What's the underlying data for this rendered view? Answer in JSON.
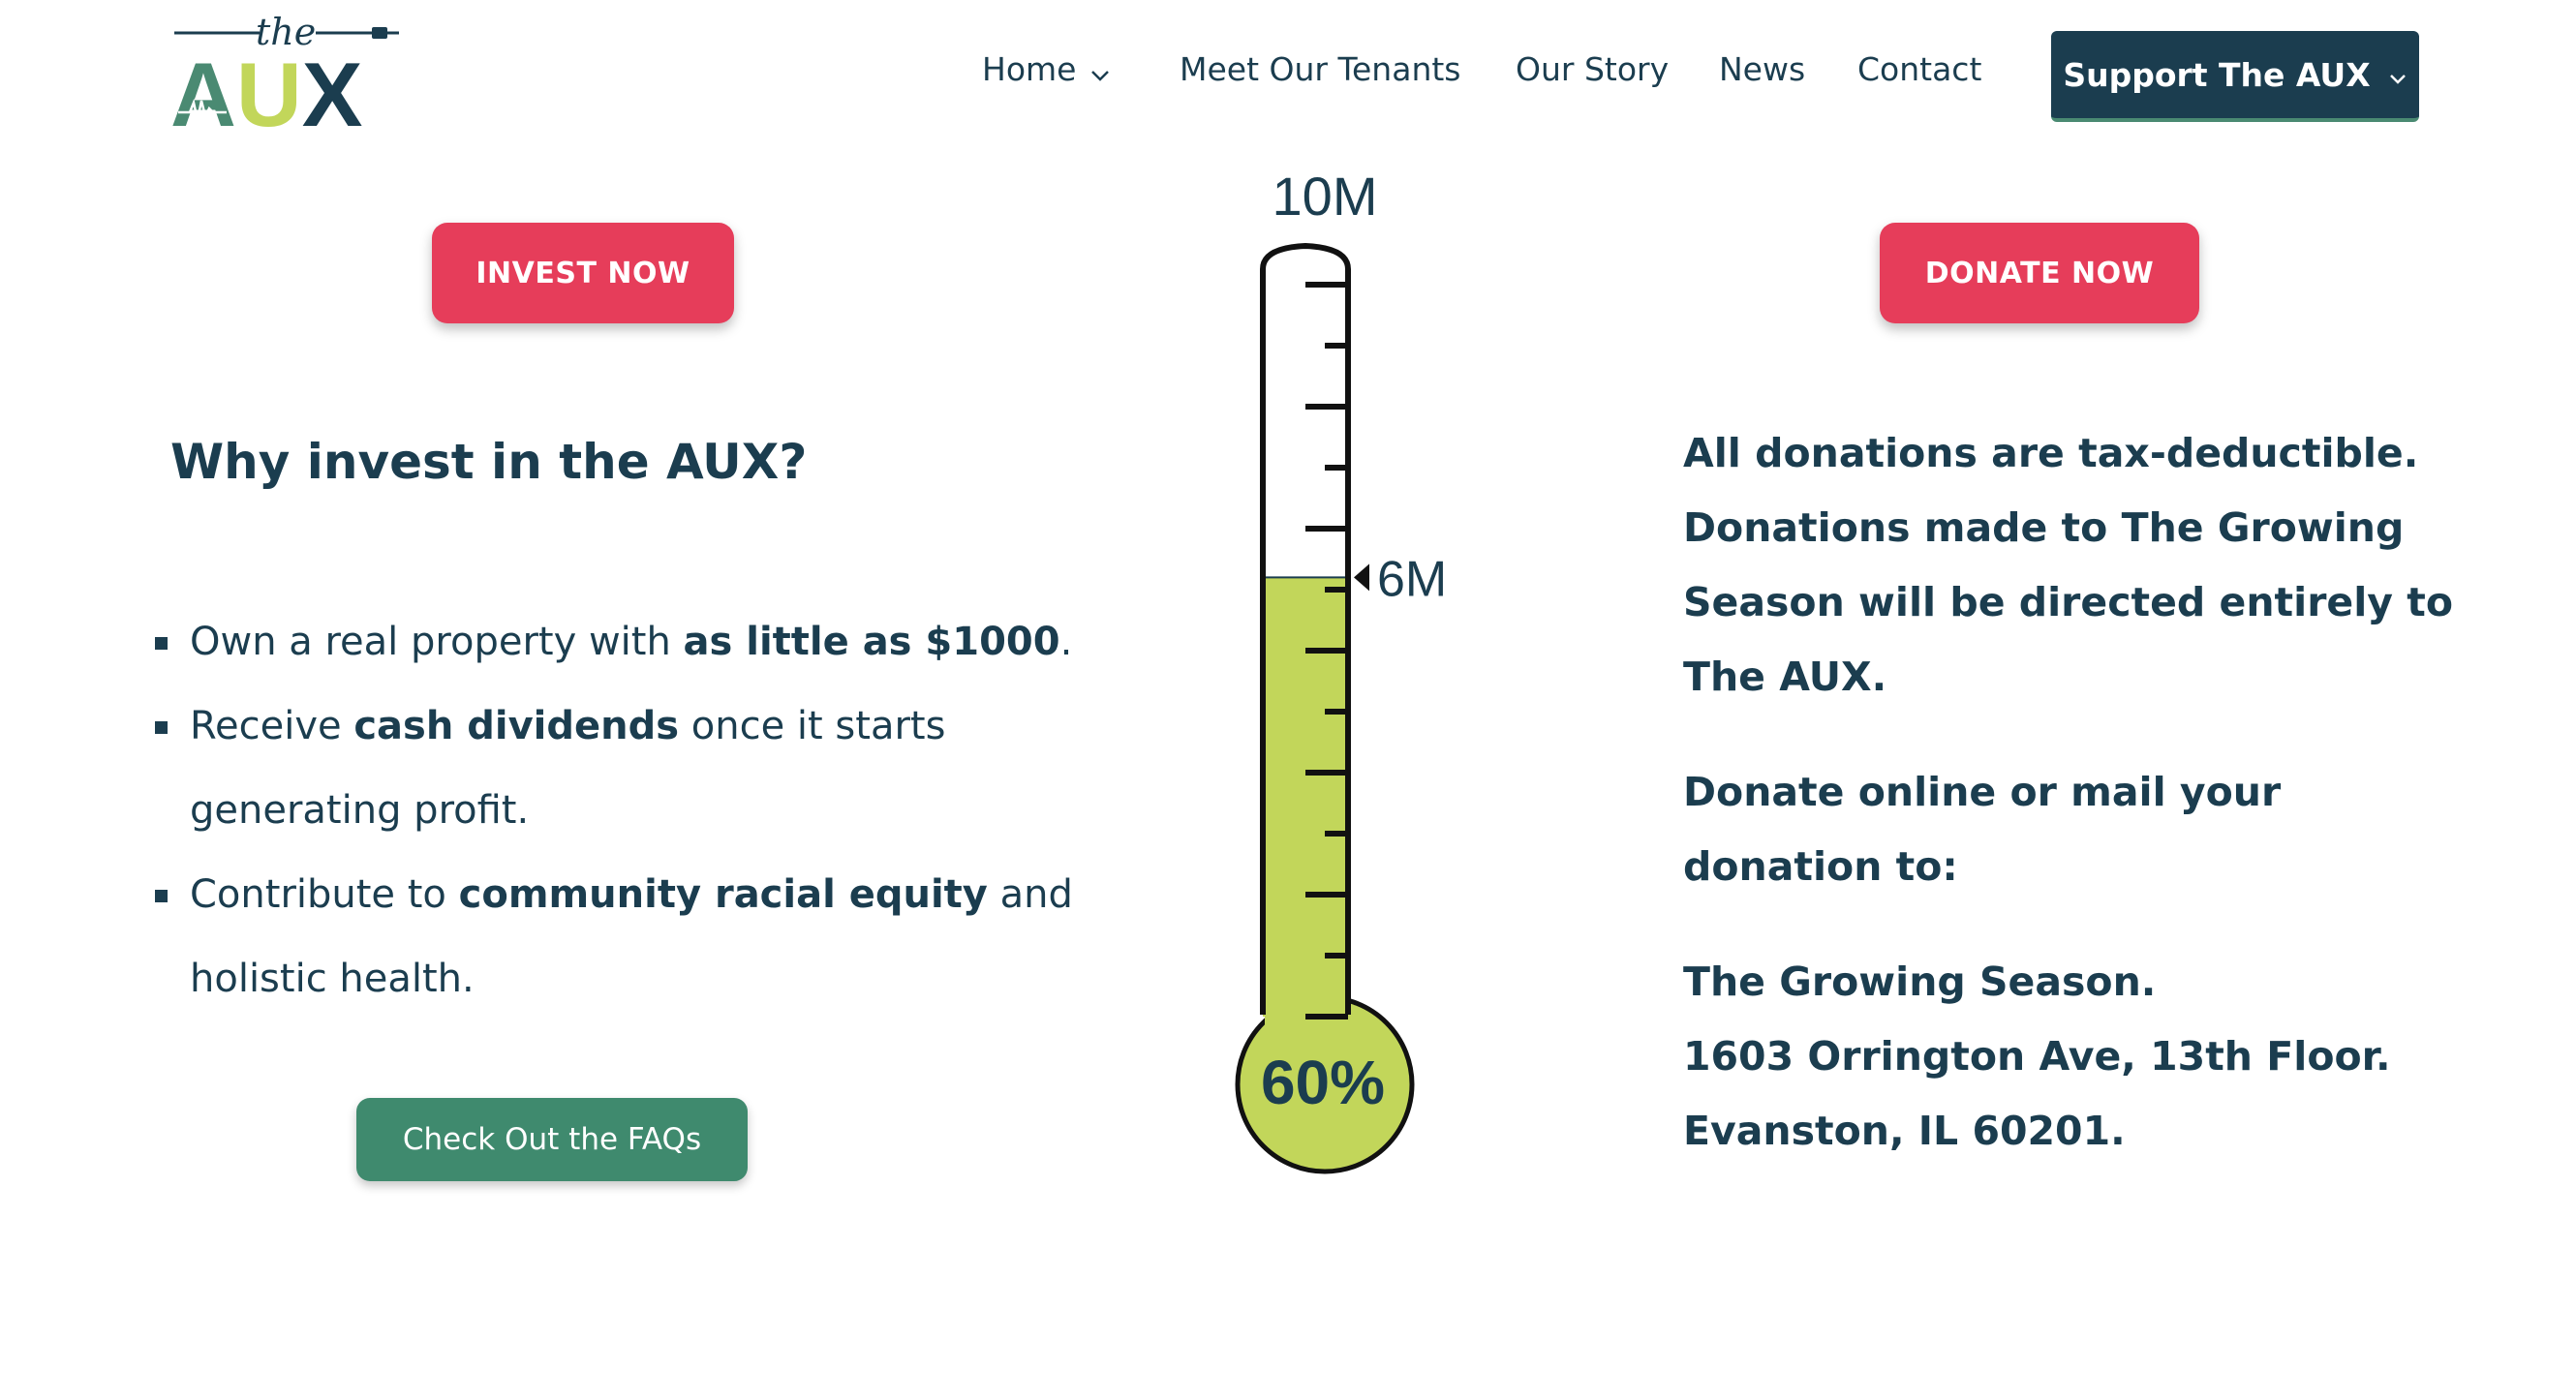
{
  "logo": {
    "small_text": "the",
    "big_text": "AUX",
    "colors": {
      "green": "#4a8a72",
      "lime": "#c2d65a",
      "navy": "#1b3d4f"
    }
  },
  "nav": {
    "items": [
      {
        "label": "Home",
        "has_dropdown": true
      },
      {
        "label": "Meet Our Tenants"
      },
      {
        "label": "Our Story"
      },
      {
        "label": "News"
      },
      {
        "label": "Contact"
      }
    ],
    "support_button": {
      "label": "Support The AUX",
      "has_dropdown": true
    }
  },
  "invest": {
    "button_label": "INVEST NOW",
    "heading": "Why invest in the AUX?",
    "benefits": [
      {
        "before": "Own a real property with ",
        "bold": "as little as $1000",
        "after": "."
      },
      {
        "before": "Receive ",
        "bold": "cash dividends",
        "after": " once it starts generating profit."
      },
      {
        "before": "Contribute to ",
        "bold": "community racial equity",
        "after": " and holistic health."
      }
    ],
    "faq_button_label": "Check Out the FAQs"
  },
  "thermometer": {
    "goal_label": "10M",
    "current_label": "6M",
    "percent_label": "60%",
    "goal_value": 10,
    "current_value": 6,
    "fill_fraction": 0.6,
    "fill_color": "#c2d65a"
  },
  "donate": {
    "button_label": "DONATE NOW",
    "tax_note": "All donations are tax-deductible. Donations made to The Growing Season will be directed entirely to The AUX.",
    "mail_note": "Donate online or mail your donation to:",
    "address_line1": "The Growing Season.",
    "address_line2": "1603 Orrington Ave, 13th Floor.",
    "address_line3": "Evanston, IL 60201."
  },
  "colors": {
    "navy": "#1b3d4f",
    "cta_red": "#e63d5a",
    "faq_green": "#3f8a6e"
  }
}
